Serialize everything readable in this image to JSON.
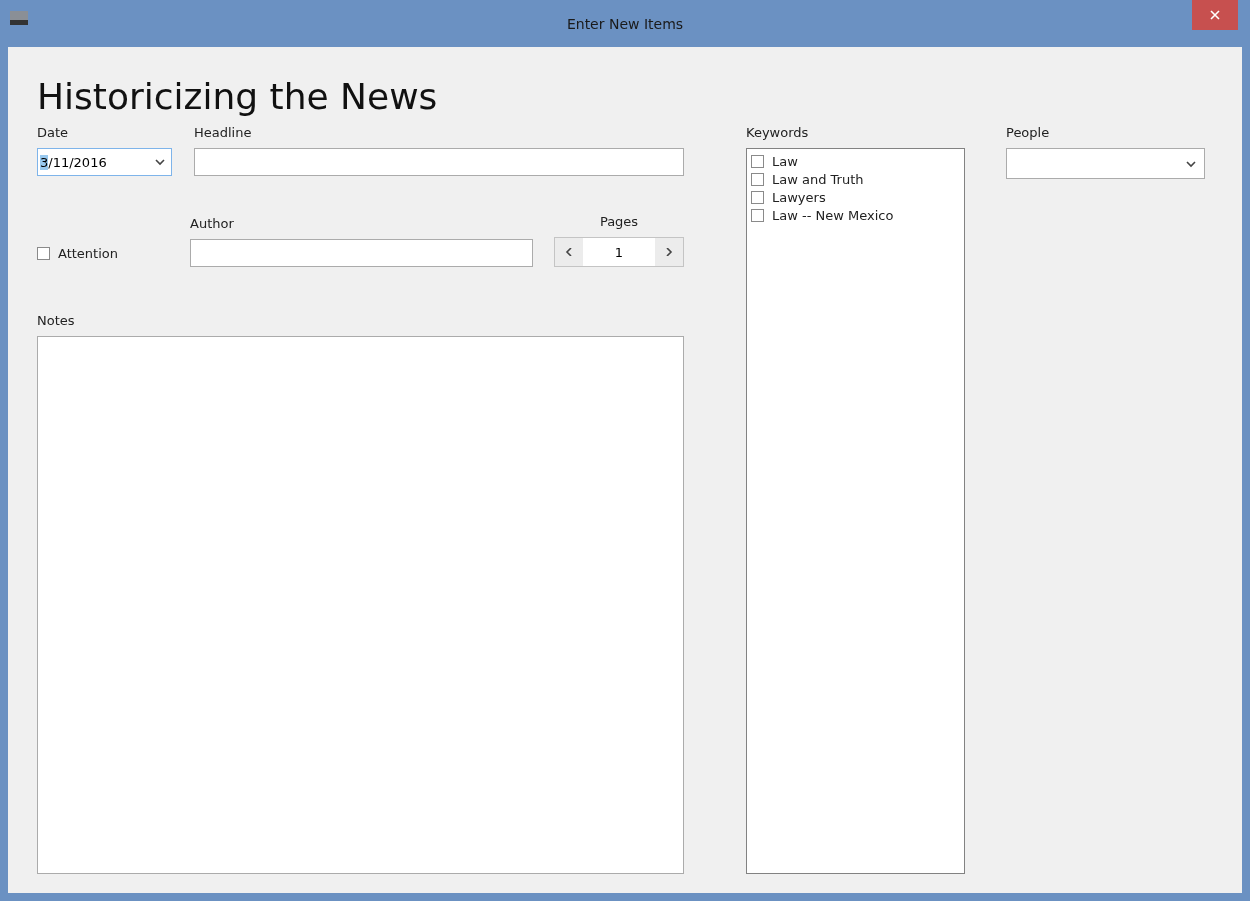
{
  "window": {
    "title": "Enter New Items"
  },
  "heading": "Historicizing the News",
  "date": {
    "label": "Date",
    "value": "3/11/2016"
  },
  "headline": {
    "label": "Headline"
  },
  "attention": {
    "label": "Attention",
    "checked": false
  },
  "author": {
    "label": "Author"
  },
  "pages": {
    "label": "Pages",
    "value": "1"
  },
  "notes": {
    "label": "Notes"
  },
  "keywords": {
    "label": "Keywords",
    "items": [
      {
        "label": "Law",
        "checked": false
      },
      {
        "label": "Law and Truth",
        "checked": false
      },
      {
        "label": "Lawyers",
        "checked": false
      },
      {
        "label": "Law -- New Mexico",
        "checked": false
      }
    ]
  },
  "people": {
    "label": "People"
  }
}
